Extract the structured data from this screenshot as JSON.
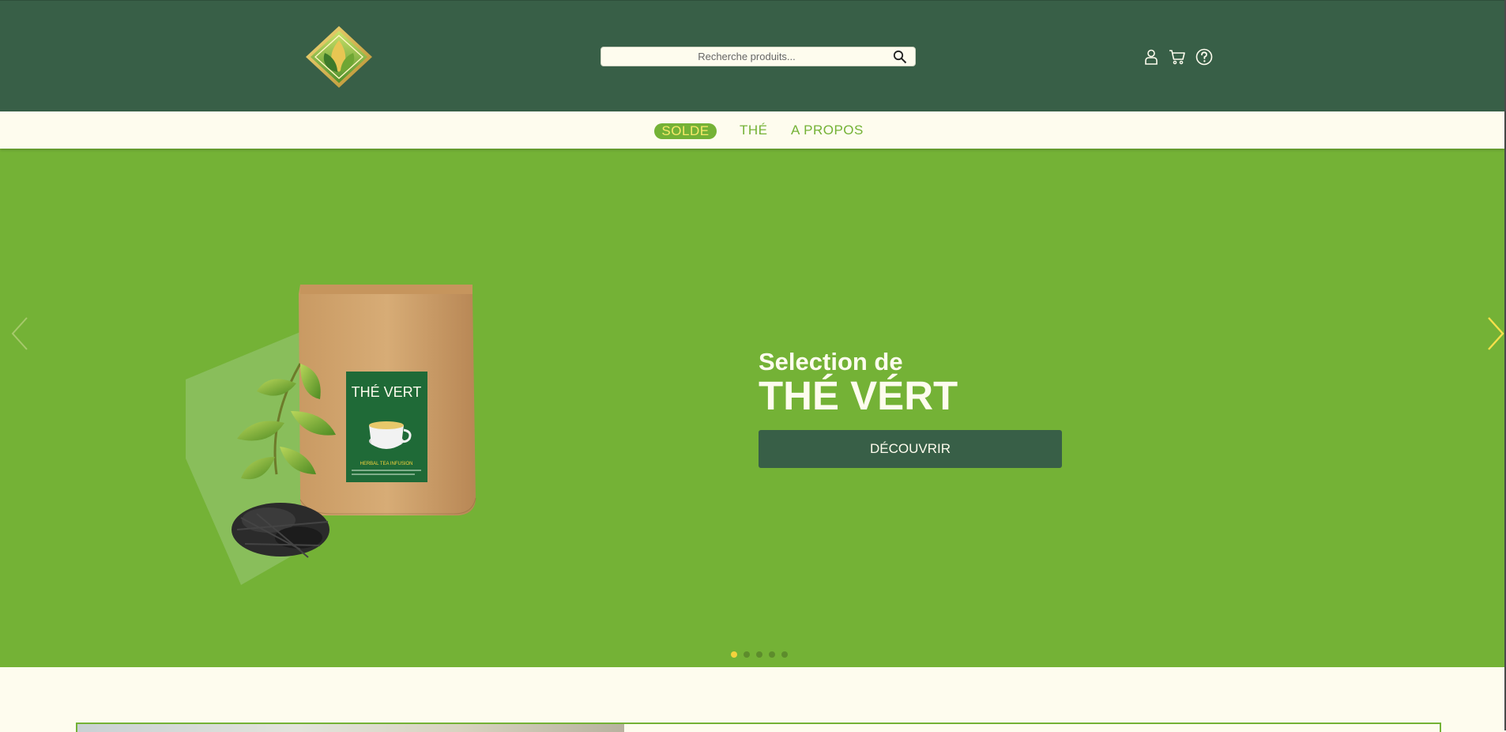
{
  "header": {
    "logo_icon": "tea-leaf-logo-icon",
    "search": {
      "placeholder": "Recherche produits...",
      "icon": "search-icon"
    },
    "icons": [
      "user-icon",
      "cart-icon",
      "help-icon"
    ]
  },
  "nav": {
    "items": [
      {
        "label": "SOLDE",
        "active": true
      },
      {
        "label": "THÉ",
        "active": false
      },
      {
        "label": "A PROPOS",
        "active": false
      }
    ]
  },
  "hero": {
    "subtitle": "Selection de",
    "title": "THÉ VÉRT",
    "cta_label": "DÉCOUVRIR",
    "product": {
      "package_label": "THÉ VERT",
      "package_sub": "HERBAL TEA INFUSION"
    },
    "slides_count": 5,
    "active_slide": 1,
    "prev_icon": "chevron-left-icon",
    "next_icon": "chevron-right-icon"
  },
  "colors": {
    "header_bg": "#385f47",
    "nav_bg": "#fefcee",
    "accent": "#74b236",
    "highlight": "#f7e96a",
    "button_bg": "#385f47",
    "dot_active": "#f4d23d"
  }
}
